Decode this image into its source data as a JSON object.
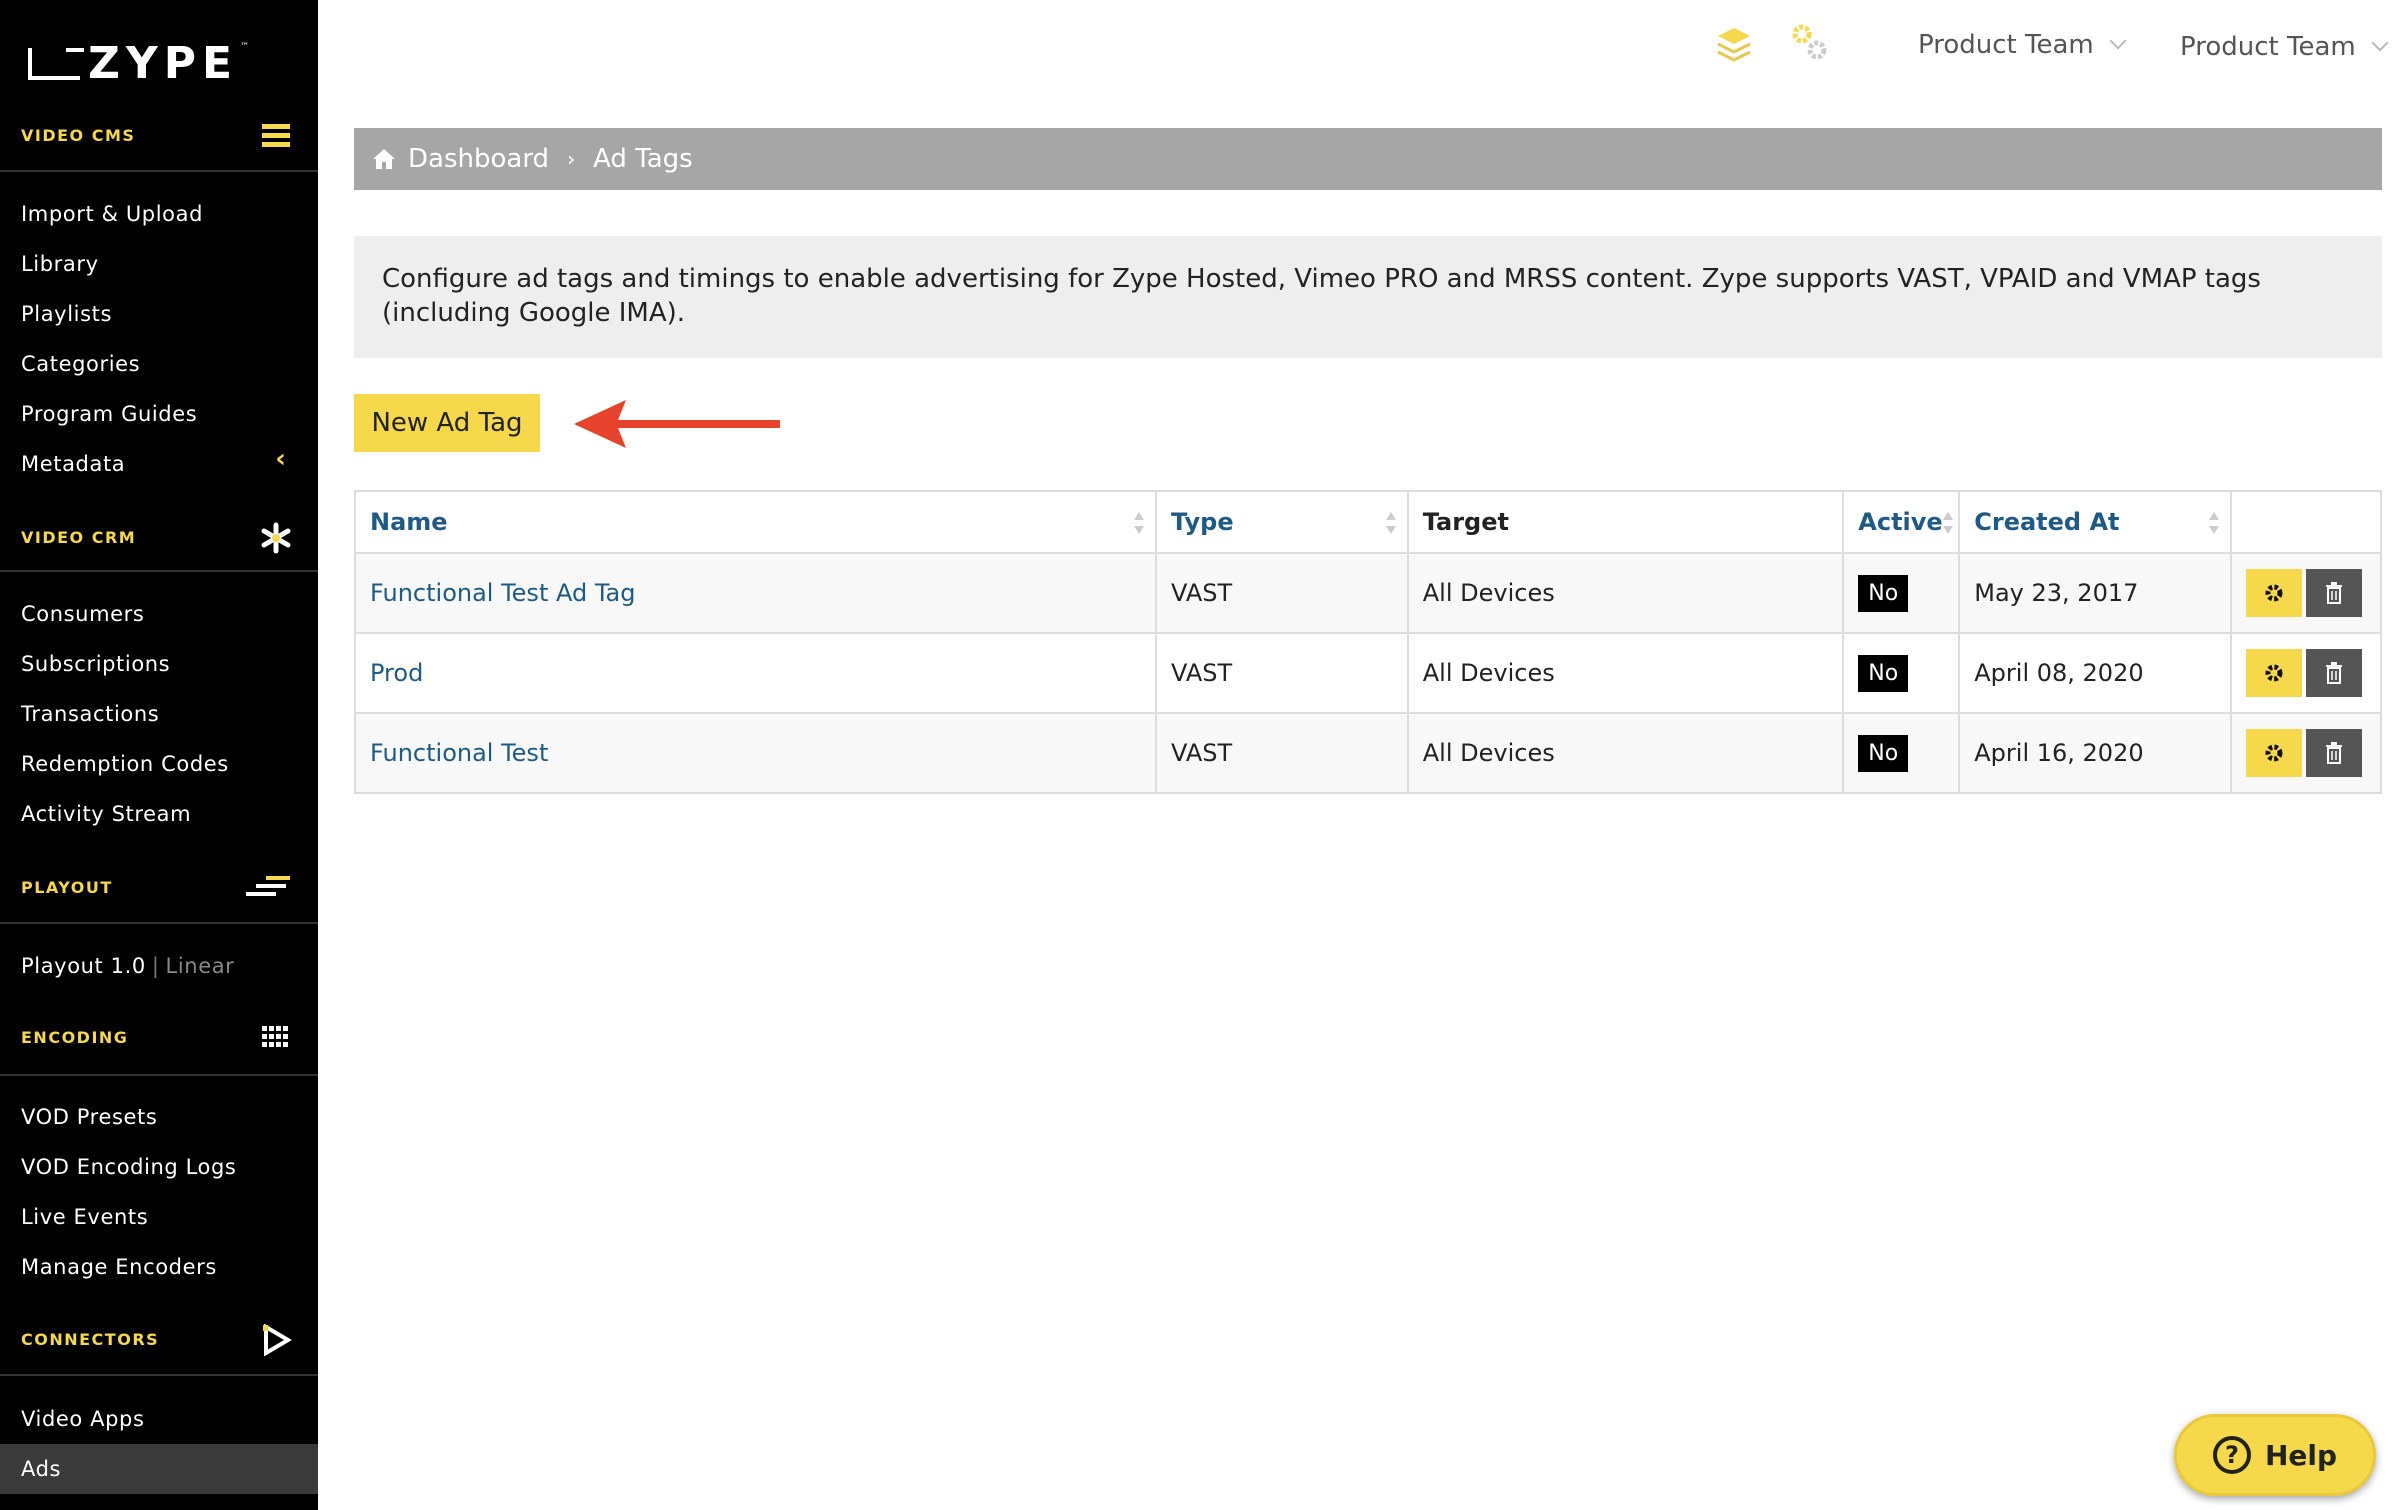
{
  "brand": {
    "logo_text": "ZYPE",
    "trademark": "™"
  },
  "sidebar": {
    "video_cms": {
      "label": "VIDEO CMS",
      "icon": "hamburger-icon",
      "items": [
        "Import & Upload",
        "Library",
        "Playlists",
        "Categories",
        "Program Guides",
        "Metadata"
      ]
    },
    "video_crm": {
      "label": "VIDEO CRM",
      "icon": "asterisk-icon",
      "items": [
        "Consumers",
        "Subscriptions",
        "Transactions",
        "Redemption Codes",
        "Activity Stream"
      ]
    },
    "playout": {
      "label": "PLAYOUT",
      "icon": "playout-lines-icon",
      "item_main": "Playout 1.0",
      "item_sep": "|",
      "item_sub": "Linear"
    },
    "encoding": {
      "label": "ENCODING",
      "icon": "grid-icon",
      "items": [
        "VOD Presets",
        "VOD Encoding Logs",
        "Live Events",
        "Manage Encoders"
      ]
    },
    "connectors": {
      "label": "CONNECTORS",
      "icon": "play-outline-icon",
      "items": [
        "Video Apps",
        "Ads"
      ]
    },
    "active_item": "Ads"
  },
  "topbar": {
    "team_select_1": "Product Team",
    "team_select_2": "Product Team"
  },
  "breadcrumb": {
    "home": "Dashboard",
    "current": "Ad Tags"
  },
  "info_text": "Configure ad tags and timings to enable advertising for Zype Hosted, Vimeo PRO and MRSS content. Zype supports VAST, VPAID and VMAP tags (including Google IMA).",
  "new_button_label": "New Ad Tag",
  "table": {
    "headers": {
      "name": "Name",
      "type": "Type",
      "target": "Target",
      "active": "Active",
      "created_at": "Created At"
    },
    "rows": [
      {
        "name": "Functional Test Ad Tag",
        "type": "VAST",
        "target": "All Devices",
        "active": "No",
        "created_at": "May 23, 2017"
      },
      {
        "name": "Prod",
        "type": "VAST",
        "target": "All Devices",
        "active": "No",
        "created_at": "April 08, 2020"
      },
      {
        "name": "Functional Test",
        "type": "VAST",
        "target": "All Devices",
        "active": "No",
        "created_at": "April 16, 2020"
      }
    ]
  },
  "help_label": "Help",
  "colors": {
    "accent_yellow": "#f5d94a",
    "link_blue": "#1f5a87",
    "annotation_red": "#e8412c",
    "sidebar_bg": "#000000"
  }
}
